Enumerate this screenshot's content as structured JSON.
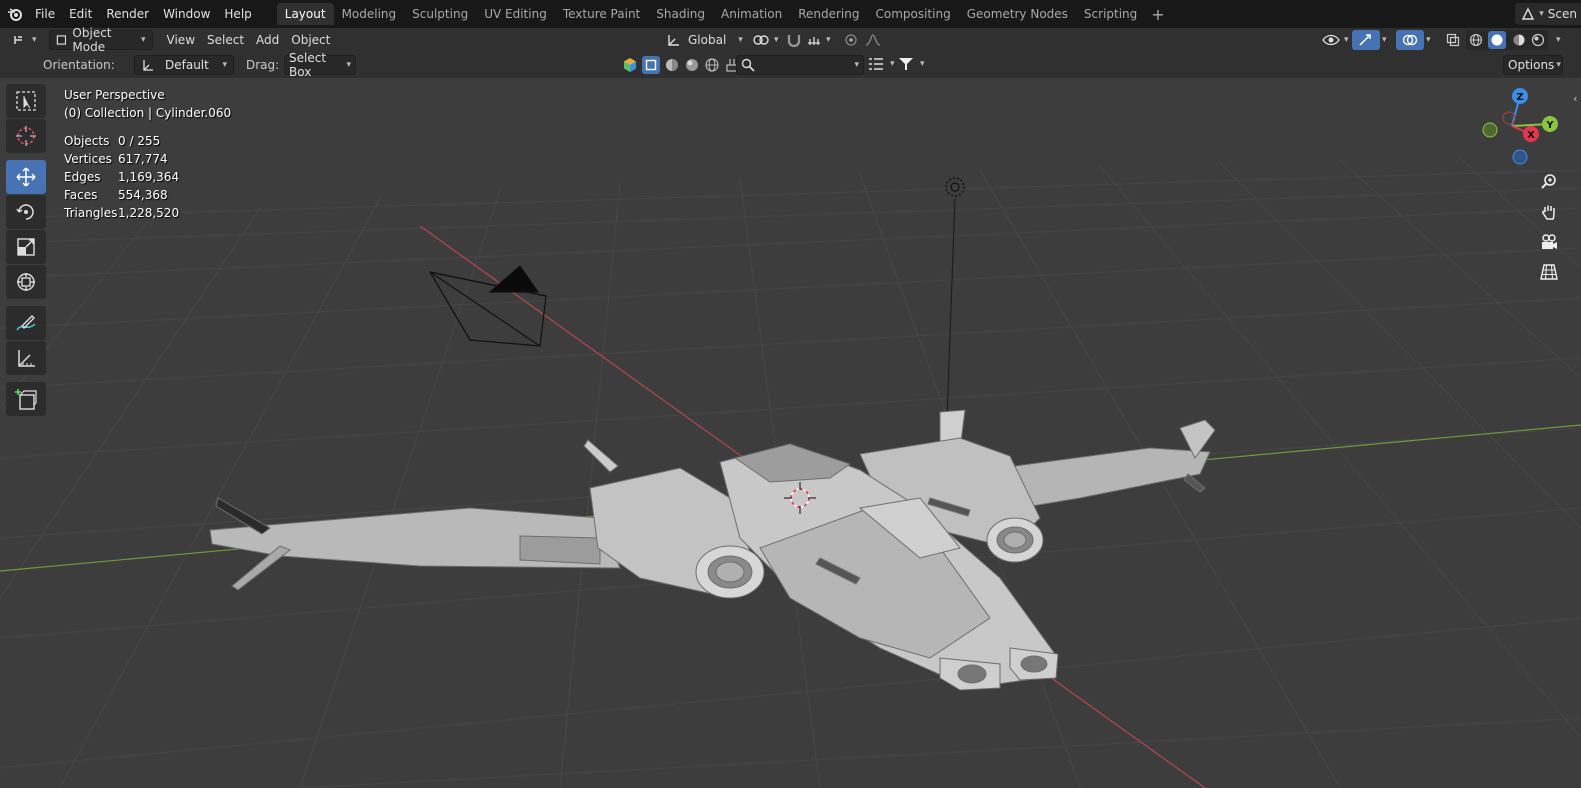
{
  "topbar": {
    "menus": [
      "File",
      "Edit",
      "Render",
      "Window",
      "Help"
    ],
    "workspaces": [
      "Layout",
      "Modeling",
      "Sculpting",
      "UV Editing",
      "Texture Paint",
      "Shading",
      "Animation",
      "Rendering",
      "Compositing",
      "Geometry Nodes",
      "Scripting"
    ],
    "active_workspace": "Layout",
    "scene_label": "Scen"
  },
  "header": {
    "mode": "Object Mode",
    "menus": [
      "View",
      "Select",
      "Add",
      "Object"
    ],
    "transform_orientation": "Global"
  },
  "tool_settings": {
    "orientation_label": "Orientation:",
    "orientation_value": "Default",
    "drag_label": "Drag:",
    "drag_value": "Select Box",
    "options_label": "Options"
  },
  "viewport": {
    "view_name": "User Perspective",
    "collection_info": "(0) Collection | Cylinder.060",
    "stats": [
      {
        "label": "Objects",
        "value": "0 / 255"
      },
      {
        "label": "Vertices",
        "value": "617,774"
      },
      {
        "label": "Edges",
        "value": "1,169,364"
      },
      {
        "label": "Faces",
        "value": "554,368"
      },
      {
        "label": "Triangles",
        "value": "1,228,520"
      }
    ]
  },
  "gizmo": {
    "x": "X",
    "y": "Y",
    "z": "Z"
  },
  "colors": {
    "accent": "#4772b3",
    "x_axis": "#e5364f",
    "y_axis": "#8bc53d",
    "z_axis": "#3d8ee5",
    "grid_bg": "#3d3d3d"
  },
  "icons": [
    "blender-logo-icon",
    "select-box-icon",
    "cursor-icon",
    "move-icon",
    "rotate-icon",
    "scale-icon",
    "transform-icon",
    "annotate-icon",
    "measure-icon",
    "add-cube-icon",
    "zoom-icon",
    "hand-icon",
    "camera-icon",
    "grid-icon"
  ]
}
